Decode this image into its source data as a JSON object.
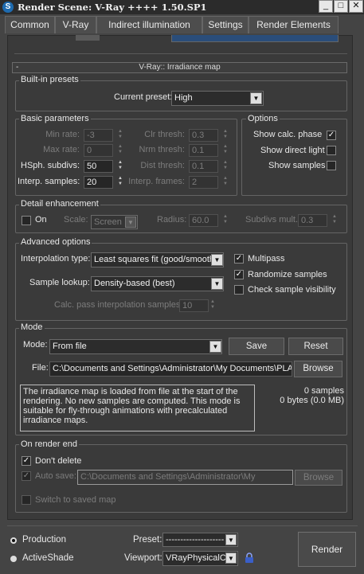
{
  "window": {
    "title": "Render Scene: V-Ray ++++ 1.50.SP1",
    "icon_letter": "S"
  },
  "title_buttons": {
    "minimize": "_",
    "maximize": "□",
    "close": "✕"
  },
  "tabs": [
    "Common",
    "V-Ray",
    "Indirect illumination",
    "Settings",
    "Render Elements"
  ],
  "rollout": {
    "collapse": "-",
    "title": "V-Ray:: Irradiance map"
  },
  "builtin_presets": {
    "title": "Built-in presets",
    "current_preset_label": "Current preset:",
    "current_preset_value": "High"
  },
  "basic_parameters": {
    "title": "Basic parameters",
    "min_rate": {
      "label": "Min rate:",
      "value": "-3"
    },
    "max_rate": {
      "label": "Max rate:",
      "value": "0"
    },
    "hsph_subdivs": {
      "label": "HSph. subdivs:",
      "value": "50"
    },
    "interp_samples": {
      "label": "Interp. samples:",
      "value": "20"
    },
    "clr_thresh": {
      "label": "Clr thresh:",
      "value": "0.3"
    },
    "nrm_thresh": {
      "label": "Nrm thresh:",
      "value": "0.1"
    },
    "dist_thresh": {
      "label": "Dist thresh:",
      "value": "0.1"
    },
    "interp_frames": {
      "label": "Interp. frames:",
      "value": "2"
    }
  },
  "options": {
    "title": "Options",
    "show_calc_phase": {
      "label": "Show calc. phase",
      "checked": true
    },
    "show_direct_light": {
      "label": "Show direct light",
      "checked": false
    },
    "show_samples": {
      "label": "Show samples",
      "checked": false
    }
  },
  "detail_enhancement": {
    "title": "Detail enhancement",
    "on_label": "On",
    "on_checked": false,
    "scale_label": "Scale:",
    "scale_value": "Screen",
    "radius_label": "Radius:",
    "radius_value": "60.0",
    "subdivs_mult_label": "Subdivs mult.",
    "subdivs_mult_value": "0.3"
  },
  "advanced_options": {
    "title": "Advanced options",
    "interpolation_type_label": "Interpolation type:",
    "interpolation_type_value": "Least squares fit (good/smooth)",
    "sample_lookup_label": "Sample lookup:",
    "sample_lookup_value": "Density-based (best)",
    "calc_pass_label": "Calc. pass interpolation samples:",
    "calc_pass_value": "10",
    "multipass": {
      "label": "Multipass",
      "checked": true
    },
    "randomize_samples": {
      "label": "Randomize samples",
      "checked": true
    },
    "check_sample_visibility": {
      "label": "Check sample visibility",
      "checked": false
    }
  },
  "mode": {
    "title": "Mode",
    "mode_label": "Mode:",
    "mode_value": "From file",
    "save_button": "Save",
    "reset_button": "Reset",
    "file_label": "File:",
    "file_value": "C:\\Documents and Settings\\Administrator\\My Documents\\PLAN",
    "browse_button": "Browse",
    "description": "The irradiance map is loaded from file at the start of the rendering. No new samples are computed. This mode is suitable for fly-through animations with precalculated irradiance maps.",
    "samples_count": "0 samples",
    "bytes_info": "0 bytes (0.0 MB)"
  },
  "on_render_end": {
    "title": "On render end",
    "dont_delete": {
      "label": "Don't delete",
      "checked": true
    },
    "auto_save": {
      "label": "Auto save:",
      "checked": true
    },
    "auto_save_path": "C:\\Documents and Settings\\Administrator\\My",
    "browse_button": "Browse",
    "switch_to_saved_map": {
      "label": "Switch to saved map",
      "checked": false
    }
  },
  "bottom": {
    "production_label": "Production",
    "activeshade_label": "ActiveShade",
    "preset_label": "Preset:",
    "preset_value": "--------------------",
    "viewport_label": "Viewport:",
    "viewport_value": "VRayPhysicalCa",
    "render_button": "Render"
  }
}
